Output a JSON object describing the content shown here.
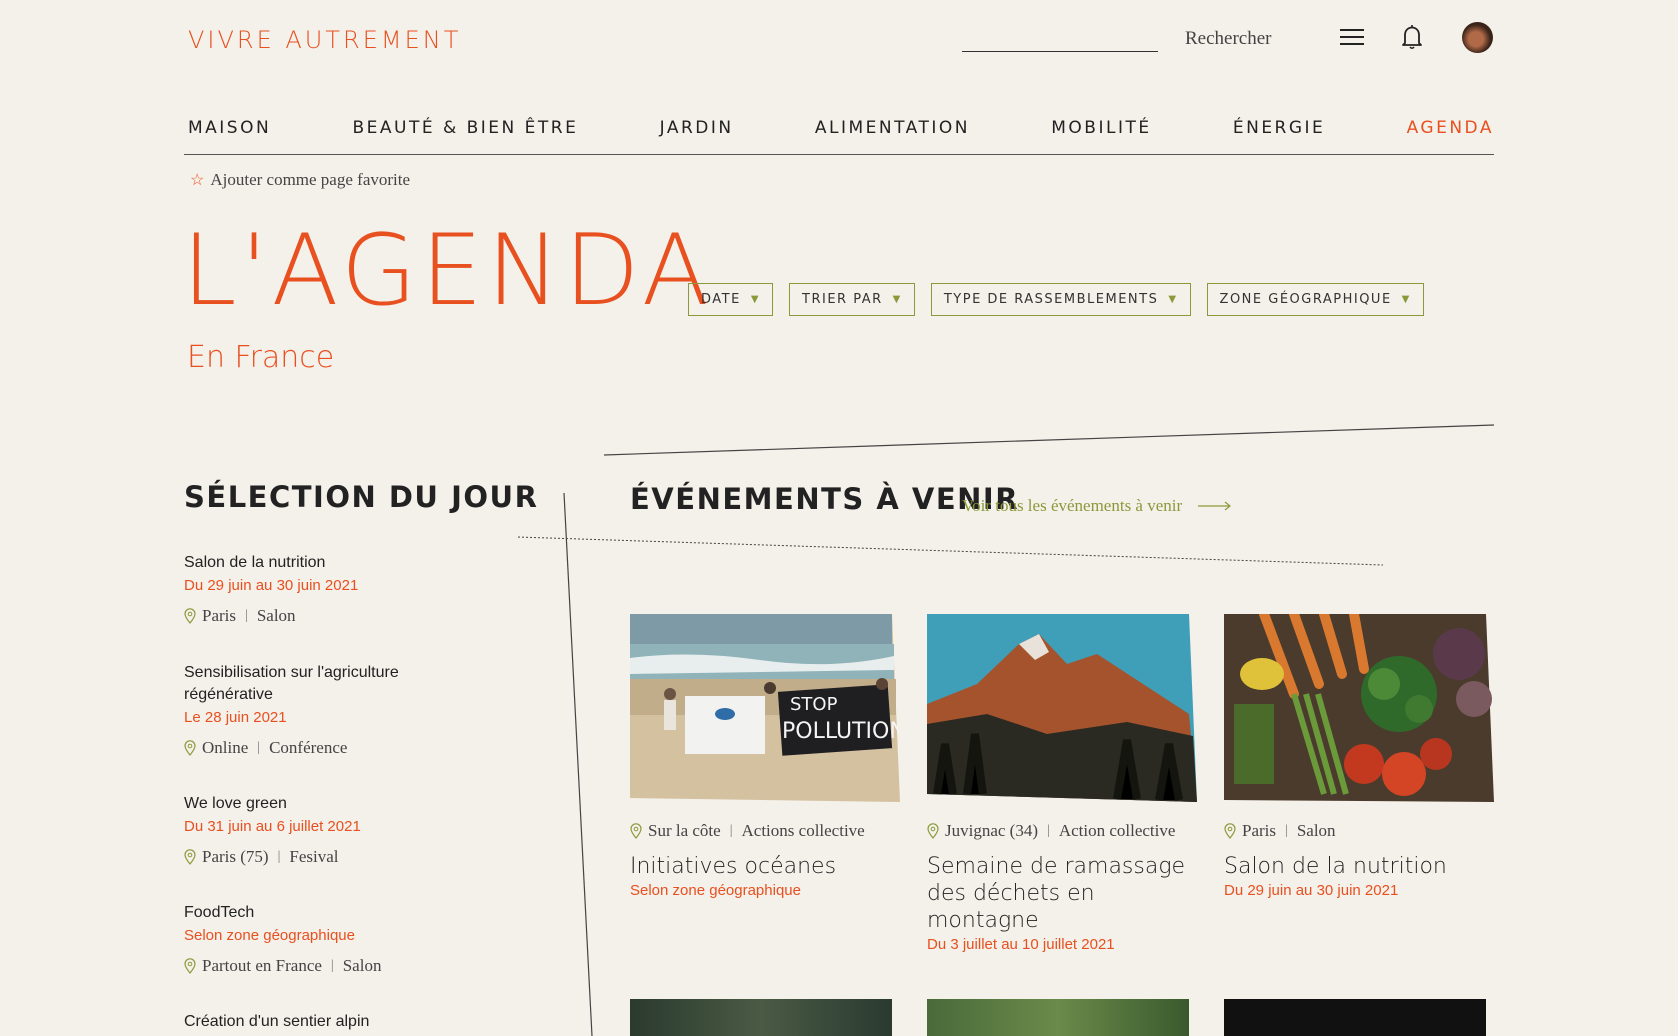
{
  "header": {
    "logo": "VIVRE AUTREMENT",
    "search_label": "Rechercher"
  },
  "nav": {
    "items": [
      "MAISON",
      "BEAUTÉ & BIEN ÊTRE",
      "JARDIN",
      "ALIMENTATION",
      "MOBILITÉ",
      "ÉNERGIE",
      "AGENDA"
    ],
    "active": "AGENDA"
  },
  "favorite": {
    "label": "Ajouter comme page favorite"
  },
  "page": {
    "title": "L'AGENDA",
    "subtitle": "En France"
  },
  "filters": [
    "DATE",
    "TRIER PAR",
    "TYPE DE RASSEMBLEMENTS",
    "ZONE GÉOGRAPHIQUE"
  ],
  "selection": {
    "heading": "SÉLECTION DU JOUR",
    "items": [
      {
        "title": "Salon de la nutrition",
        "date": "Du 29 juin au 30 juin 2021",
        "place": "Paris",
        "type": "Salon"
      },
      {
        "title": "Sensibilisation sur l'agriculture régénérative",
        "date": "Le 28 juin 2021",
        "place": "Online",
        "type": "Conférence"
      },
      {
        "title": "We love green",
        "date": "Du 31 juin  au 6 juillet 2021",
        "place": "Paris (75)",
        "type": "Fesival"
      },
      {
        "title": "FoodTech",
        "date": "Selon zone géographique",
        "place": "Partout en France",
        "type": "Salon"
      },
      {
        "title": "Création d'un sentier alpin",
        "date": "",
        "place": "",
        "type": ""
      }
    ]
  },
  "events": {
    "heading": "ÉVÉNEMENTS À VENIR",
    "see_all": "Voir tous les événements à venir",
    "cards": [
      {
        "image": "beach-protest-photo",
        "place": "Sur la côte",
        "type": "Actions collective",
        "title": "Initiatives océanes",
        "date": "Selon zone géographique"
      },
      {
        "image": "mountain-photo",
        "place": "Juvignac (34)",
        "type": "Action collective",
        "title": "Semaine de ramassage des déchets en montagne",
        "date": "Du 3 juillet au 10 juillet 2021"
      },
      {
        "image": "vegetables-photo",
        "place": "Paris",
        "type": "Salon",
        "title": "Salon de la nutrition",
        "date": "Du 29 juin au 30 juin 2021"
      }
    ]
  },
  "colors": {
    "accent": "#e8501f",
    "olive": "#8a9a3a",
    "background": "#f4f0ea",
    "text": "#222222"
  }
}
